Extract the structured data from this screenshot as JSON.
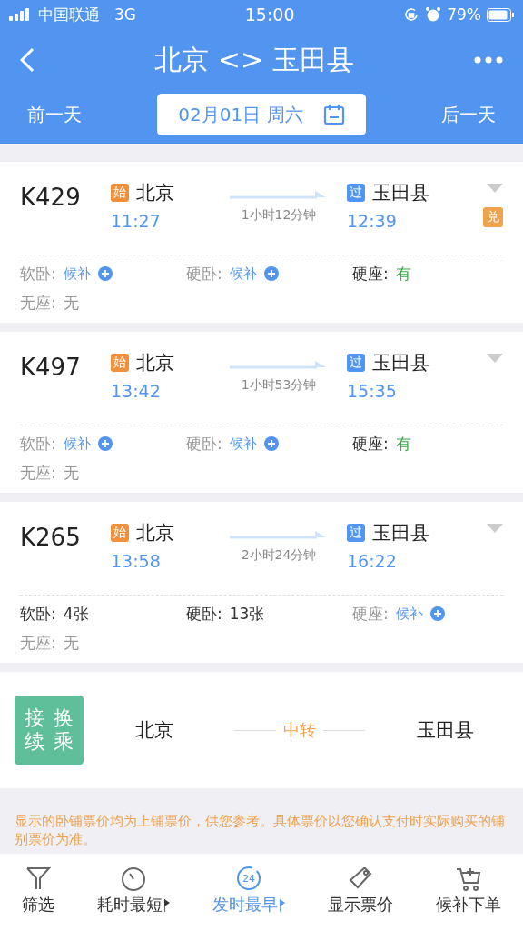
{
  "status_bar": {
    "carrier": "中国联通",
    "network": "3G",
    "time": "15:00",
    "battery": "79%"
  },
  "nav": {
    "title": "北京 <> 玉田县"
  },
  "date_bar": {
    "prev": "前一天",
    "date": "02月01日 周六",
    "next": "后一天"
  },
  "trains": [
    {
      "number": "K429",
      "from": {
        "badge": "始",
        "kind": "start",
        "station": "北京",
        "time": "11:27"
      },
      "duration": "1小时12分钟",
      "to": {
        "badge": "过",
        "kind": "pass",
        "station": "玉田县",
        "time": "12:39"
      },
      "tag": "兑",
      "seats": [
        {
          "label": "软卧:",
          "value": "候补",
          "kind": "waitlist"
        },
        {
          "label": "硬卧:",
          "value": "候补",
          "kind": "waitlist"
        },
        {
          "label": "硬座:",
          "value": "有",
          "kind": "available"
        },
        {
          "label": "无座:",
          "value": "无",
          "kind": "none"
        }
      ]
    },
    {
      "number": "K497",
      "from": {
        "badge": "始",
        "kind": "start",
        "station": "北京",
        "time": "13:42"
      },
      "duration": "1小时53分钟",
      "to": {
        "badge": "过",
        "kind": "pass",
        "station": "玉田县",
        "time": "15:35"
      },
      "seats": [
        {
          "label": "软卧:",
          "value": "候补",
          "kind": "waitlist"
        },
        {
          "label": "硬卧:",
          "value": "候补",
          "kind": "waitlist"
        },
        {
          "label": "硬座:",
          "value": "有",
          "kind": "available"
        },
        {
          "label": "无座:",
          "value": "无",
          "kind": "none"
        }
      ]
    },
    {
      "number": "K265",
      "from": {
        "badge": "始",
        "kind": "start",
        "station": "北京",
        "time": "13:58"
      },
      "duration": "2小时24分钟",
      "to": {
        "badge": "过",
        "kind": "pass",
        "station": "玉田县",
        "time": "16:22"
      },
      "seats": [
        {
          "label": "软卧:",
          "value": "4张",
          "kind": "count"
        },
        {
          "label": "硬卧:",
          "value": "13张",
          "kind": "count"
        },
        {
          "label": "硬座:",
          "value": "候补",
          "kind": "waitlist"
        },
        {
          "label": "无座:",
          "value": "无",
          "kind": "none"
        }
      ]
    }
  ],
  "transfer": {
    "badge_columns": [
      "接续",
      "换乘"
    ],
    "from": "北京",
    "via": "中转",
    "to": "玉田县"
  },
  "notice": "显示的卧铺票价均为上铺票价，供您参考。具体票价以您确认支付时实际购买的铺别票价为准。",
  "bottom_bar": [
    {
      "kind": "filter",
      "label": "筛选",
      "selected": false,
      "sortable": false
    },
    {
      "kind": "timer",
      "label": "耗时最短",
      "selected": false,
      "sortable": true
    },
    {
      "kind": "clock24",
      "label": "发时最早",
      "icon_text": "24",
      "selected": true,
      "sortable": true
    },
    {
      "kind": "price",
      "label": "显示票价",
      "selected": false,
      "sortable": false
    },
    {
      "kind": "cart",
      "label": "候补下单",
      "selected": false,
      "sortable": false
    }
  ]
}
